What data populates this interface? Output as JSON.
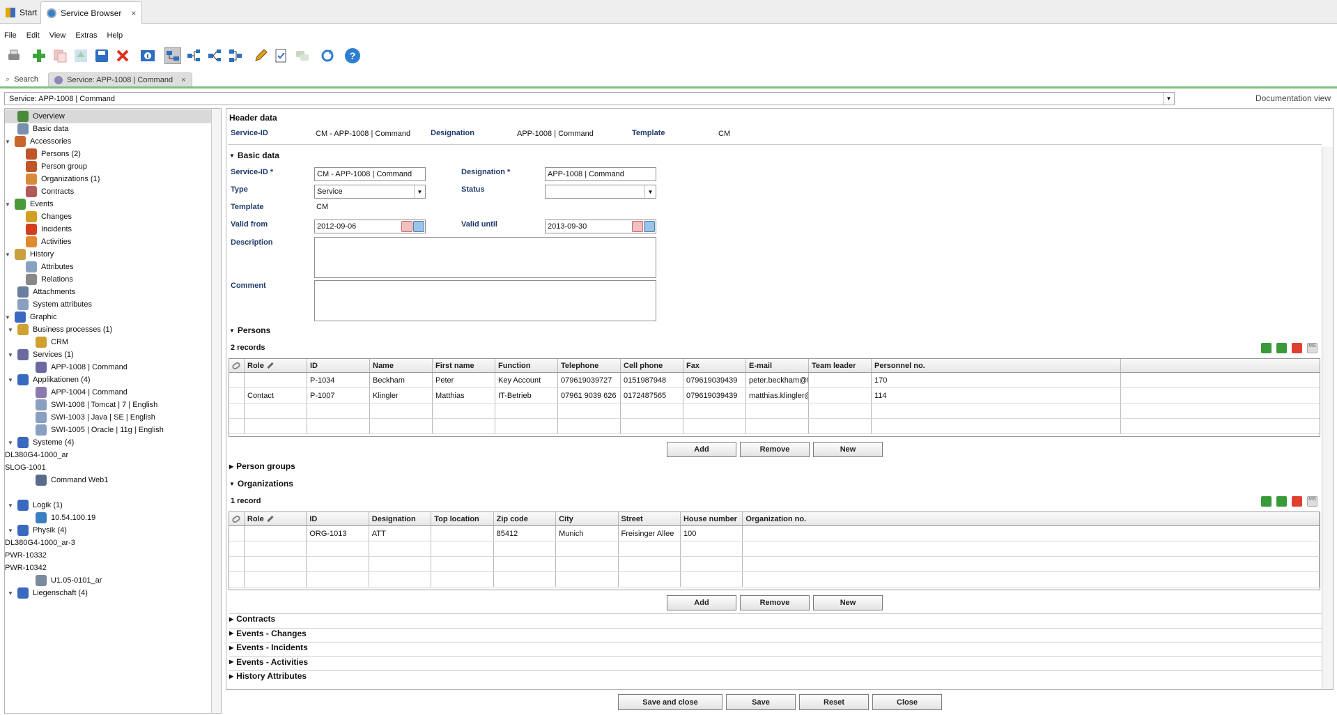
{
  "app": {
    "tabs": [
      {
        "label": "Start"
      },
      {
        "label": "Service Browser"
      }
    ]
  },
  "menu": [
    "File",
    "Edit",
    "View",
    "Extras",
    "Help"
  ],
  "doctabs": {
    "search": "Search",
    "service": "Service: APP-1008 | Command"
  },
  "address": "Service: APP-1008 | Command",
  "docview": "Documentation view",
  "tree": [
    {
      "label": "Overview",
      "icon": "overview-icon",
      "color": "#4a8a3c",
      "indent": 1,
      "toggle": "",
      "selected": true
    },
    {
      "label": "Basic data",
      "icon": "document-icon",
      "color": "#7a8fb0",
      "indent": 1,
      "toggle": ""
    },
    {
      "label": "Accessories",
      "icon": "accessories-icon",
      "color": "#c9662a",
      "indent": 0,
      "toggle": "▼"
    },
    {
      "label": "Persons (2)",
      "icon": "person-icon",
      "color": "#c0552a",
      "indent": 2,
      "toggle": ""
    },
    {
      "label": "Person group",
      "icon": "person-group-icon",
      "color": "#c0552a",
      "indent": 2,
      "toggle": ""
    },
    {
      "label": "Organizations (1)",
      "icon": "organization-icon",
      "color": "#d88a3a",
      "indent": 2,
      "toggle": ""
    },
    {
      "label": "Contracts",
      "icon": "contract-icon",
      "color": "#b55a5a",
      "indent": 2,
      "toggle": ""
    },
    {
      "label": "Events",
      "icon": "events-icon",
      "color": "#4a9a3a",
      "indent": 0,
      "toggle": "▼"
    },
    {
      "label": "Changes",
      "icon": "changes-icon",
      "color": "#d0a020",
      "indent": 2,
      "toggle": ""
    },
    {
      "label": "Incidents",
      "icon": "incident-icon",
      "color": "#d04020",
      "indent": 2,
      "toggle": ""
    },
    {
      "label": "Activities",
      "icon": "activity-icon",
      "color": "#e08a30",
      "indent": 2,
      "toggle": ""
    },
    {
      "label": "History",
      "icon": "history-icon",
      "color": "#c9a040",
      "indent": 0,
      "toggle": "▼"
    },
    {
      "label": "Attributes",
      "icon": "attributes-icon",
      "color": "#8aa0c0",
      "indent": 2,
      "toggle": ""
    },
    {
      "label": "Relations",
      "icon": "relations-icon",
      "color": "#888888",
      "indent": 2,
      "toggle": ""
    },
    {
      "label": "Attachments",
      "icon": "paperclip-icon",
      "color": "#6a7fa0",
      "indent": 1,
      "toggle": ""
    },
    {
      "label": "System attributes",
      "icon": "system-attributes-icon",
      "color": "#8aa0c0",
      "indent": 1,
      "toggle": ""
    },
    {
      "label": "Graphic",
      "icon": "graphic-icon",
      "color": "#3a6ac0",
      "indent": 0,
      "toggle": "▼"
    },
    {
      "label": "Business processes (1)",
      "icon": "business-process-icon",
      "color": "#d0a030",
      "indent": 1,
      "toggle": "▼"
    },
    {
      "label": "CRM",
      "icon": "crm-icon",
      "color": "#d0a030",
      "indent": 3,
      "toggle": ""
    },
    {
      "label": "Services (1)",
      "icon": "service-icon",
      "color": "#6a6aa0",
      "indent": 1,
      "toggle": "▼"
    },
    {
      "label": "APP-1008 | Command",
      "icon": "service-icon",
      "color": "#6a6aa0",
      "indent": 3,
      "toggle": ""
    },
    {
      "label": "Applikationen (4)",
      "icon": "application-icon",
      "color": "#3a6ac0",
      "indent": 1,
      "toggle": "▼"
    },
    {
      "label": "APP-1004 | Command",
      "icon": "application-icon",
      "color": "#8a7ab0",
      "indent": 3,
      "toggle": ""
    },
    {
      "label": "SWI-1008 | Tomcat | 7 | English",
      "icon": "software-icon",
      "color": "#8aa0c0",
      "indent": 3,
      "toggle": ""
    },
    {
      "label": "SWI-1003 | Java | SE | English",
      "icon": "software-icon",
      "color": "#8aa0c0",
      "indent": 3,
      "toggle": ""
    },
    {
      "label": "SWI-1005 | Oracle | 11g | English",
      "icon": "software-icon",
      "color": "#8aa0c0",
      "indent": 3,
      "toggle": ""
    },
    {
      "label": "Systeme (4)",
      "icon": "system-icon",
      "color": "#3a6ac0",
      "indent": 1,
      "toggle": "▼"
    },
    {
      "label": "DL380G4-1000_ar",
      "icon": "",
      "color": "",
      "indent": -1,
      "toggle": ""
    },
    {
      "label": "SLOG-1001",
      "icon": "",
      "color": "",
      "indent": -1,
      "toggle": ""
    },
    {
      "label": "Command Web1",
      "icon": "server-icon",
      "color": "#5a6a8a",
      "indent": 3,
      "toggle": ""
    },
    {
      "label": "",
      "icon": "",
      "color": "",
      "indent": -1,
      "toggle": ""
    },
    {
      "label": "Logik (1)",
      "icon": "logic-icon",
      "color": "#3a6ac0",
      "indent": 1,
      "toggle": "▼"
    },
    {
      "label": "10.54.100.19",
      "icon": "network-icon",
      "color": "#3a80c0",
      "indent": 3,
      "toggle": ""
    },
    {
      "label": "Physik (4)",
      "icon": "physical-icon",
      "color": "#3a6ac0",
      "indent": 1,
      "toggle": "▼"
    },
    {
      "label": "DL380G4-1000_ar-3",
      "icon": "",
      "color": "",
      "indent": -1,
      "toggle": ""
    },
    {
      "label": "PWR-10332",
      "icon": "",
      "color": "",
      "indent": -1,
      "toggle": ""
    },
    {
      "label": "PWR-10342",
      "icon": "",
      "color": "",
      "indent": -1,
      "toggle": ""
    },
    {
      "label": "U1.05-0101_ar",
      "icon": "rack-icon",
      "color": "#7a8aa0",
      "indent": 3,
      "toggle": ""
    },
    {
      "label": "Liegenschaft (4)",
      "icon": "property-icon",
      "color": "#3a6ac0",
      "indent": 1,
      "toggle": "▼"
    }
  ],
  "header": {
    "title": "Header data",
    "service_id_label": "Service-ID",
    "service_id": "CM - APP-1008 | Command",
    "designation_label": "Designation",
    "designation": "APP-1008 | Command",
    "template_label": "Template",
    "template": "CM"
  },
  "basic": {
    "title": "Basic data",
    "service_id_label": "Service-ID *",
    "service_id": "CM - APP-1008 | Command",
    "designation_label": "Designation *",
    "designation": "APP-1008 | Command",
    "type_label": "Type",
    "type": "Service",
    "status_label": "Status",
    "status": "",
    "template_label": "Template",
    "template": "CM",
    "valid_from_label": "Valid from",
    "valid_from": "2012-09-06",
    "valid_until_label": "Valid until",
    "valid_until": "2013-09-30",
    "description_label": "Description",
    "comment_label": "Comment"
  },
  "persons": {
    "title": "Persons",
    "count": "2 records",
    "columns": [
      "",
      "Role",
      "ID",
      "Name",
      "First name",
      "Function",
      "Telephone",
      "Cell phone",
      "Fax",
      "E-mail",
      "Team leader",
      "Personnel no."
    ],
    "rows": [
      [
        "",
        "",
        "P-1034",
        "Beckham",
        "Peter",
        "Key Account",
        "079619039727",
        "0151987948",
        "079619039439",
        "peter.beckham@fnts.",
        "",
        "170"
      ],
      [
        "",
        "Contact",
        "P-1007",
        "Klingler",
        "Matthias",
        "IT-Betrieb",
        "07961 9039 626",
        "0172487565",
        "079619039439",
        "matthias.klingler@fnt.",
        "",
        "114"
      ]
    ],
    "add": "Add",
    "remove": "Remove",
    "new": "New"
  },
  "person_groups": "Person groups",
  "orgs": {
    "title": "Organizations",
    "count": "1 record",
    "columns": [
      "",
      "Role",
      "ID",
      "Designation",
      "Top location",
      "Zip code",
      "City",
      "Street",
      "House number",
      "Organization no."
    ],
    "rows": [
      [
        "",
        "",
        "ORG-1013",
        "ATT",
        "",
        "85412",
        "Munich",
        "Freisinger Allee",
        "100",
        ""
      ]
    ],
    "add": "Add",
    "remove": "Remove",
    "new": "New"
  },
  "collapsed": [
    "Contracts",
    "Events - Changes",
    "Events - Incidents",
    "Events - Activities",
    "History Attributes"
  ],
  "footer": {
    "save_close": "Save and close",
    "save": "Save",
    "reset": "Reset",
    "close": "Close"
  }
}
